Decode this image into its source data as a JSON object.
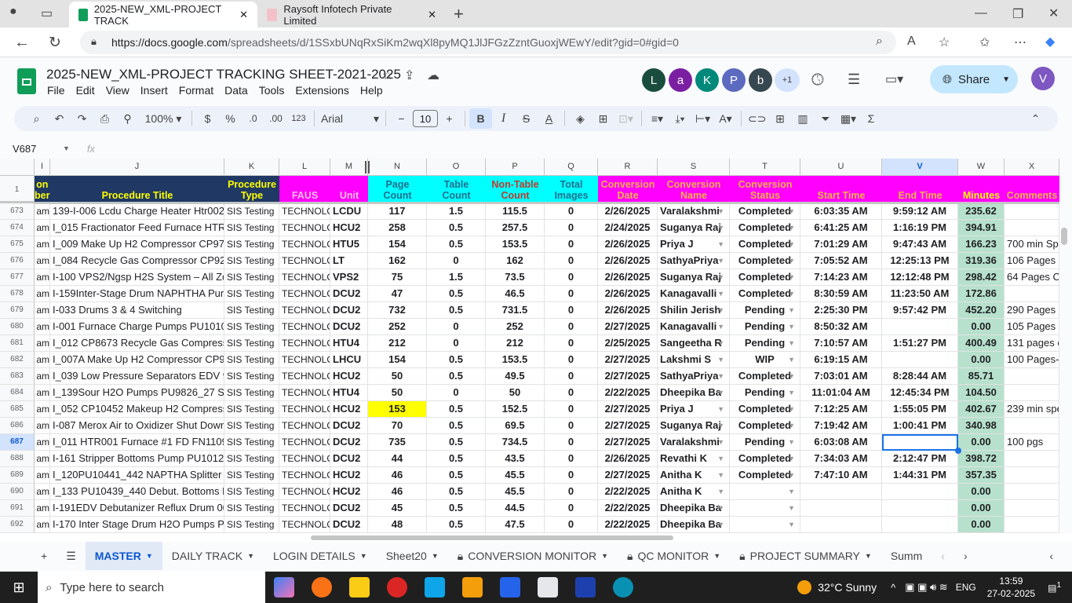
{
  "browser": {
    "tabs": [
      {
        "title": "2025-NEW_XML-PROJECT TRACK",
        "active": true
      },
      {
        "title": "Raysoft Infotech Private Limited",
        "active": false
      }
    ],
    "url_domain": "https://docs.google.com",
    "url_path": "/spreadsheets/d/1SSxbUNqRxSiKm2wqXl8pyMQ1JlJFGzZzntGuoxjWEwY/edit?gid=0#gid=0"
  },
  "doc": {
    "title": "2025-NEW_XML-PROJECT TRACKING SHEET-2021-2025",
    "menu": [
      "File",
      "Edit",
      "View",
      "Insert",
      "Format",
      "Data",
      "Tools",
      "Extensions",
      "Help"
    ],
    "avatars": [
      {
        "letter": "L",
        "color": "#1b4d3e"
      },
      {
        "letter": "a",
        "color": "#7b1fa2"
      },
      {
        "letter": "K",
        "color": "#00897b"
      },
      {
        "letter": "P",
        "color": "#5c6bc0"
      },
      {
        "letter": "b",
        "color": "#37474f"
      }
    ],
    "more_users": "+1",
    "share_label": "Share",
    "user_avatar": "V"
  },
  "toolbar": {
    "zoom": "100%",
    "currency": "$",
    "percent": "%",
    "dec_decrease": ".0",
    "dec_increase": ".00",
    "format_number": "123",
    "font": "Arial",
    "font_size": "10",
    "bold": "B",
    "italic": "I"
  },
  "formula_bar": {
    "cell_ref": "V687",
    "fx": "fx",
    "value": ""
  },
  "columns": [
    "",
    "I",
    "J",
    "K",
    "L",
    "M",
    "N",
    "O",
    "P",
    "Q",
    "R",
    "S",
    "T",
    "U",
    "V",
    "W",
    "X"
  ],
  "selected_column": "V",
  "header_row": {
    "row": "1",
    "cells": [
      "on\nber",
      "Procedure Title",
      "Procedure\nType",
      "FAUS",
      "Unit",
      "Page Count",
      "Table Count",
      "Non-Table\nCount",
      "Total\nImages",
      "Conversion\nDate",
      "Conversion\nName",
      "Conversion\nStatus",
      "Start Time",
      "End Time",
      "Minutes",
      "Comments"
    ]
  },
  "colors": {
    "header_blue": "#1f3864",
    "header_magenta": "#ff00ff",
    "header_cyan": "#00ffff",
    "minutes_fill": "#b7e1cd",
    "highlight_yellow": "#ffff00",
    "selection": "#1a73e8",
    "yellow_text": "#ffff00"
  },
  "rows": [
    [
      "673",
      "am",
      "139-I-006 Lcdu Charge Heater Htr002",
      "SIS Testing",
      "TECHNOLOGY",
      "LCDU",
      "117",
      "1.5",
      "115.5",
      "0",
      "2/26/2025",
      "Varalakshmi",
      "Completed",
      "6:03:35 AM",
      "9:59:12 AM",
      "235.62",
      ""
    ],
    [
      "674",
      "am",
      "I_015 Fractionator Feed Furnace HTR00",
      "SIS Testing",
      "TECHNOLOGY",
      "HCU2",
      "258",
      "0.5",
      "257.5",
      "0",
      "2/24/2025",
      "Suganya Raj",
      "Completed",
      "6:41:25 AM",
      "1:16:19 PM",
      "394.91",
      ""
    ],
    [
      "675",
      "am",
      "I_009 Make Up H2 Compressor CP9714",
      "SIS Testing",
      "TECHNOLOGY",
      "HTU5",
      "154",
      "0.5",
      "153.5",
      "0",
      "2/26/2025",
      "Priya J",
      "Completed",
      "7:01:29 AM",
      "9:47:43 AM",
      "166.23",
      "700 min Spe"
    ],
    [
      "676",
      "am",
      "I_084 Recycle Gas Compressor CP9212",
      "SIS Testing",
      "TECHNOLOGY",
      "LT",
      "162",
      "0",
      "162",
      "0",
      "2/26/2025",
      "SathyaPriya",
      "Completed",
      "7:05:52 AM",
      "12:25:13 PM",
      "319.36",
      "106 Pages C"
    ],
    [
      "677",
      "am",
      "I-100 VPS2/Ngsp H2S System – All Zone",
      "SIS Testing",
      "TECHNOLOGY",
      "VPS2",
      "75",
      "1.5",
      "73.5",
      "0",
      "2/26/2025",
      "Suganya Raj",
      "Completed",
      "7:14:23 AM",
      "12:12:48 PM",
      "298.42",
      "64 Pages Co"
    ],
    [
      "678",
      "am",
      "I-159Inter-Stage Drum NAPHTHA Pumps",
      "SIS Testing",
      "TECHNOLOGY",
      "DCU2",
      "47",
      "0.5",
      "46.5",
      "0",
      "2/26/2025",
      "Kanagavalli",
      "Completed",
      "8:30:59 AM",
      "11:23:50 AM",
      "172.86",
      ""
    ],
    [
      "679",
      "am",
      "I-033 Drums 3 & 4 Switching",
      "SIS Testing",
      "TECHNOLOGY",
      "DCU2",
      "732",
      "0.5",
      "731.5",
      "0",
      "2/26/2025",
      "Shilin Jerish",
      "Pending",
      "2:25:30 PM",
      "9:57:42 PM",
      "452.20",
      "290 Pages C"
    ],
    [
      "680",
      "am",
      "I-001 Furnace Charge Pumps PU10101/1",
      "SIS Testing",
      "TECHNOLOGY",
      "DCU2",
      "252",
      "0",
      "252",
      "0",
      "2/27/2025",
      "Kanagavalli",
      "Pending",
      "8:50:32 AM",
      "",
      "0.00",
      "105 Pages"
    ],
    [
      "681",
      "am",
      "I_012 CP8673 Recycle Gas Compressor",
      "SIS Testing",
      "TECHNOLOGY",
      "HTU4",
      "212",
      "0",
      "212",
      "0",
      "2/25/2025",
      "Sangeetha R",
      "Pending",
      "7:10:57 AM",
      "1:51:27 PM",
      "400.49",
      "131 pages c"
    ],
    [
      "682",
      "am",
      "I_007A Make Up H2 Compressor CP971",
      "SIS Testing",
      "TECHNOLOGY",
      "LHCU",
      "154",
      "0.5",
      "153.5",
      "0",
      "2/27/2025",
      "Lakshmi S",
      "WIP",
      "6:19:15 AM",
      "",
      "0.00",
      "100 Pages-1"
    ],
    [
      "683",
      "am",
      "I_039 Low Pressure Separators EDV 9H2",
      "SIS Testing",
      "TECHNOLOGY",
      "HCU2",
      "50",
      "0.5",
      "49.5",
      "0",
      "2/27/2025",
      "SathyaPriya",
      "Completed",
      "7:03:01 AM",
      "8:28:44 AM",
      "85.71",
      ""
    ],
    [
      "684",
      "am",
      "I_139Sour H2O Pumps PU9826_27 Suct",
      "SIS Testing",
      "TECHNOLOGY",
      "HTU4",
      "50",
      "0",
      "50",
      "0",
      "2/22/2025",
      "Dheepika Ba",
      "Pending",
      "11:01:04 AM",
      "12:45:34 PM",
      "104.50",
      ""
    ],
    [
      "685",
      "am",
      "I_052 CP10452 Makeup H2 Compressor",
      "SIS Testing",
      "TECHNOLOGY",
      "HCU2",
      "153",
      "0.5",
      "152.5",
      "0",
      "2/27/2025",
      "Priya J",
      "Completed",
      "7:12:25 AM",
      "1:55:05 PM",
      "402.67",
      "239 min spe"
    ],
    [
      "686",
      "am",
      "I-087 Merox  Air to Oxidizer Shut Down",
      "SIS Testing",
      "TECHNOLOGY",
      "DCU2",
      "70",
      "0.5",
      "69.5",
      "0",
      "2/27/2025",
      "Suganya Raj",
      "Completed",
      "7:19:42 AM",
      "1:00:41 PM",
      "340.98",
      ""
    ],
    [
      "687",
      "am",
      "I_011 HTR001 Furnace #1 FD FN11094,",
      "SIS Testing",
      "TECHNOLOGY",
      "DCU2",
      "735",
      "0.5",
      "734.5",
      "0",
      "2/27/2025",
      "Varalakshmi",
      "Pending",
      "6:03:08 AM",
      "",
      "0.00",
      "100 pgs"
    ],
    [
      "688",
      "am",
      "I-161 Stripper Bottoms Pump PU10128 (4",
      "SIS Testing",
      "TECHNOLOGY",
      "DCU2",
      "44",
      "0.5",
      "43.5",
      "0",
      "2/26/2025",
      "Revathi K",
      "Completed",
      "7:34:03 AM",
      "2:12:47 PM",
      "398.72",
      ""
    ],
    [
      "689",
      "am",
      "I_120PU10441_442 NAPTHA Splitter Re",
      "SIS Testing",
      "TECHNOLOGY",
      "HCU2",
      "46",
      "0.5",
      "45.5",
      "0",
      "2/27/2025",
      "Anitha K",
      "Completed",
      "7:47:10 AM",
      "1:44:31 PM",
      "357.35",
      ""
    ],
    [
      "690",
      "am",
      "I_133 PU10439_440 Debut. Bottoms Pur",
      "SIS Testing",
      "TECHNOLOGY",
      "HCU2",
      "46",
      "0.5",
      "45.5",
      "0",
      "2/22/2025",
      "Anitha K",
      "",
      "",
      "",
      "0.00",
      ""
    ],
    [
      "691",
      "am",
      "I-191EDV Debutanizer Reflux Drum 005\\",
      "SIS Testing",
      "TECHNOLOGY",
      "DCU2",
      "45",
      "0.5",
      "44.5",
      "0",
      "2/22/2025",
      "Dheepika Ba",
      "",
      "",
      "",
      "0.00",
      ""
    ],
    [
      "692",
      "am",
      "I-170 Inter Stage Drum H2O Pumps PU1",
      "SIS Testing",
      "TECHNOLOGY",
      "DCU2",
      "48",
      "0.5",
      "47.5",
      "0",
      "2/22/2025",
      "Dheepika Ba",
      "",
      "",
      "",
      "0.00",
      ""
    ]
  ],
  "selected_cell": "V687",
  "highlighted_cell": "N685",
  "sheet_tabs": [
    {
      "label": "MASTER",
      "active": true,
      "locked": false
    },
    {
      "label": "DAILY TRACK",
      "locked": false
    },
    {
      "label": "LOGIN DETAILS",
      "locked": false
    },
    {
      "label": "Sheet20",
      "locked": false
    },
    {
      "label": "CONVERSION MONITOR",
      "locked": true
    },
    {
      "label": "QC MONITOR",
      "locked": true
    },
    {
      "label": "PROJECT SUMMARY",
      "locked": true
    },
    {
      "label": "Summ",
      "locked": false
    }
  ],
  "taskbar": {
    "search_placeholder": "Type here to search",
    "weather": "32°C  Sunny",
    "lang": "ENG",
    "time": "13:59",
    "date": "27-02-2025",
    "notifications": "1"
  }
}
